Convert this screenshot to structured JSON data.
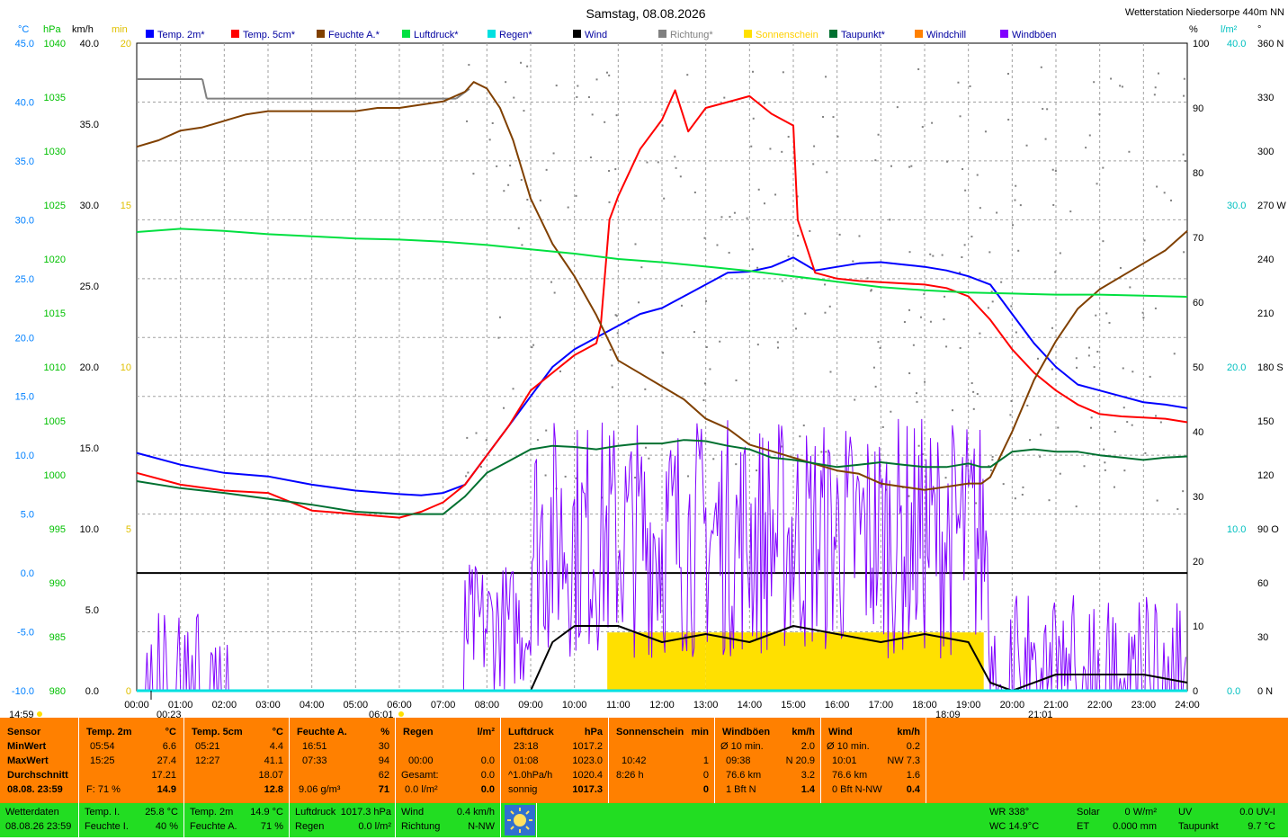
{
  "title": "Samstag, 08.08.2026",
  "station": "Wetterstation Niedersorpe 440m NN",
  "legend": [
    {
      "name": "Temp. 2m*",
      "color": "#0000ff"
    },
    {
      "name": "Temp. 5cm*",
      "color": "#ff0000"
    },
    {
      "name": "Feuchte A.*",
      "color": "#804000"
    },
    {
      "name": "Luftdruck*",
      "color": "#00e040"
    },
    {
      "name": "Regen*",
      "color": "#00e0e0"
    },
    {
      "name": "Wind",
      "color": "#000000"
    },
    {
      "name": "Richtung*",
      "color": "#808080"
    },
    {
      "name": "Sonnenschein",
      "color": "#ffe000"
    },
    {
      "name": "Taupunkt*",
      "color": "#007030"
    },
    {
      "name": "Windchill",
      "color": "#ff8000"
    },
    {
      "name": "Windböen",
      "color": "#8000ff"
    }
  ],
  "axis_units": {
    "temp": "°C",
    "hpa": "hPa",
    "kmh": "km/h",
    "min": "min",
    "pct": "%",
    "lm2": "l/m²",
    "deg": "°"
  },
  "axes": {
    "temp": {
      "color": "#0080ff",
      "ticks": [
        "45.0",
        "40.0",
        "35.0",
        "30.0",
        "25.0",
        "20.0",
        "15.0",
        "10.0",
        "5.0",
        "0.0",
        "-5.0",
        "-10.0"
      ]
    },
    "hpa": {
      "color": "#00c000",
      "ticks": [
        "1040",
        "1035",
        "1030",
        "1025",
        "1020",
        "1015",
        "1010",
        "1005",
        "1000",
        "995",
        "990",
        "985",
        "980"
      ]
    },
    "kmh": {
      "color": "#000000",
      "ticks": [
        "40.0",
        "35.0",
        "30.0",
        "25.0",
        "20.0",
        "15.0",
        "10.0",
        "5.0",
        "0.0"
      ]
    },
    "min": {
      "color": "#e0c000",
      "ticks": [
        "20",
        "15",
        "10",
        "5",
        "0"
      ]
    },
    "pct": {
      "color": "#000000",
      "ticks": [
        "100",
        "90",
        "80",
        "70",
        "60",
        "50",
        "40",
        "30",
        "20",
        "10",
        "0"
      ]
    },
    "lm2": {
      "color": "#00c0c0",
      "ticks": [
        "40.0",
        "30.0",
        "20.0",
        "10.0",
        "0.0"
      ]
    },
    "deg": {
      "color": "#000000",
      "ticks": [
        "360 N",
        "330",
        "300",
        "270 W",
        "240",
        "210",
        "180 S",
        "150",
        "120",
        "90 O",
        "60",
        "30",
        "0 N"
      ]
    }
  },
  "x_ticks": [
    "00:00",
    "01:00",
    "02:00",
    "03:00",
    "04:00",
    "05:00",
    "06:00",
    "07:00",
    "08:00",
    "09:00",
    "10:00",
    "11:00",
    "12:00",
    "13:00",
    "14:00",
    "15:00",
    "16:00",
    "17:00",
    "18:00",
    "19:00",
    "20:00",
    "21:00",
    "22:00",
    "23:00",
    "24:00"
  ],
  "markers": {
    "left": "14:59",
    "moonrise": "00:23",
    "sunrise": "06:01",
    "sunset": "18:09",
    "moonset": "21:01"
  },
  "chart_data": {
    "type": "line",
    "x_range": [
      0,
      24
    ],
    "series": [
      {
        "name": "Temp. 2m*",
        "axis": "temp",
        "color": "#0000ff",
        "x": [
          0,
          1,
          2,
          3,
          4,
          5,
          6,
          6.5,
          7,
          7.5,
          8,
          8.5,
          9,
          9.5,
          10,
          10.5,
          11,
          11.5,
          12,
          12.5,
          13,
          13.5,
          14,
          14.5,
          15,
          15.5,
          16,
          16.5,
          17,
          17.5,
          18,
          18.5,
          19,
          19.5,
          20,
          20.5,
          21,
          21.5,
          22,
          22.5,
          23,
          23.5,
          24
        ],
        "y": [
          10.2,
          9.2,
          8.5,
          8.2,
          7.5,
          7.0,
          6.7,
          6.6,
          6.8,
          7.5,
          10.0,
          12.5,
          15.0,
          17.5,
          19.0,
          20.0,
          21.0,
          22.0,
          22.5,
          23.5,
          24.5,
          25.5,
          25.6,
          26.0,
          26.8,
          25.7,
          26.0,
          26.3,
          26.4,
          26.2,
          26.0,
          25.7,
          25.2,
          24.5,
          22.0,
          19.5,
          17.5,
          16.0,
          15.5,
          15.0,
          14.5,
          14.3,
          14.0
        ]
      },
      {
        "name": "Temp. 5cm*",
        "axis": "temp",
        "color": "#ff0000",
        "x": [
          0,
          1,
          2,
          3,
          4,
          5,
          6,
          6.5,
          7,
          7.5,
          8,
          8.5,
          9,
          9.5,
          10,
          10.5,
          10.6,
          10.8,
          11,
          11.5,
          12,
          12.3,
          12.6,
          13,
          13.5,
          14,
          14.5,
          15,
          15.1,
          15.5,
          16,
          16.5,
          17,
          17.5,
          18,
          18.5,
          19,
          19.5,
          20,
          20.5,
          21,
          21.5,
          22,
          22.5,
          23,
          23.5,
          24
        ],
        "y": [
          8.5,
          7.5,
          7.0,
          6.8,
          5.3,
          5.0,
          4.7,
          5.2,
          6.0,
          7.5,
          10.0,
          12.5,
          15.5,
          17.0,
          18.5,
          19.5,
          21.0,
          30.0,
          32.0,
          36.0,
          38.5,
          41.0,
          37.5,
          39.5,
          40.0,
          40.5,
          39.0,
          38.0,
          30.0,
          25.5,
          25.0,
          24.8,
          24.7,
          24.6,
          24.5,
          24.2,
          23.5,
          21.5,
          19.0,
          17.0,
          15.5,
          14.3,
          13.5,
          13.3,
          13.2,
          13.1,
          12.8
        ]
      },
      {
        "name": "Feuchte A.*",
        "axis": "pct",
        "color": "#804000",
        "x": [
          0,
          0.5,
          1,
          1.5,
          2,
          2.5,
          3,
          3.5,
          4,
          5,
          5.5,
          6,
          6.5,
          7,
          7.5,
          7.7,
          8,
          8.3,
          8.6,
          9,
          9.5,
          10,
          10.5,
          11,
          11.5,
          12,
          12.5,
          13,
          13.5,
          14,
          14.5,
          15,
          15.5,
          16,
          16.5,
          17,
          17.5,
          18,
          18.5,
          19,
          19.3,
          19.5,
          20,
          20.5,
          21,
          21.5,
          22,
          22.5,
          23,
          23.5,
          24
        ],
        "y": [
          84,
          85,
          86.5,
          87,
          88,
          89,
          89.5,
          89.5,
          89.5,
          89.5,
          90,
          90,
          90.5,
          91,
          92.5,
          94,
          93,
          90,
          85,
          76,
          69,
          64,
          58,
          51,
          49,
          47,
          45,
          42,
          40.5,
          38,
          37,
          36,
          35,
          34,
          33.5,
          32,
          31.5,
          31,
          31.5,
          32,
          32,
          33,
          40,
          48,
          54,
          59,
          62,
          64,
          66,
          68,
          71
        ]
      },
      {
        "name": "Luftdruck*",
        "axis": "hpa",
        "color": "#00e040",
        "x": [
          0,
          1,
          2,
          3,
          4,
          5,
          6,
          7,
          8,
          9,
          10,
          11,
          12,
          13,
          14,
          15,
          16,
          17,
          18,
          19,
          20,
          21,
          22,
          23,
          24
        ],
        "y": [
          1022.5,
          1022.8,
          1022.6,
          1022.3,
          1022.1,
          1021.9,
          1021.8,
          1021.6,
          1021.3,
          1020.9,
          1020.5,
          1020.0,
          1019.7,
          1019.3,
          1018.9,
          1018.4,
          1017.9,
          1017.4,
          1017.1,
          1016.9,
          1016.8,
          1016.7,
          1016.7,
          1016.6,
          1016.5
        ]
      },
      {
        "name": "Taupunkt*",
        "axis": "temp",
        "color": "#007030",
        "x": [
          0,
          1,
          2,
          3,
          4,
          5,
          6,
          7,
          7.5,
          8,
          8.5,
          9,
          9.5,
          10,
          10.5,
          11,
          11.5,
          12,
          12.5,
          13,
          13.5,
          14,
          14.5,
          15,
          15.5,
          16,
          16.5,
          17,
          17.5,
          18,
          18.5,
          19,
          19.3,
          19.5,
          20,
          20.5,
          21,
          21.5,
          22,
          22.5,
          23,
          23.5,
          24
        ],
        "y": [
          7.8,
          7.2,
          6.8,
          6.3,
          5.8,
          5.2,
          5.0,
          5.0,
          6.5,
          8.5,
          9.5,
          10.5,
          10.8,
          10.7,
          10.5,
          10.8,
          11.0,
          11.0,
          11.3,
          11.2,
          10.8,
          10.5,
          9.8,
          9.6,
          9.3,
          9.0,
          9.2,
          9.4,
          9.2,
          9.0,
          9.0,
          9.3,
          9.0,
          9.0,
          10.3,
          10.5,
          10.3,
          10.3,
          10.0,
          9.8,
          9.6,
          9.8,
          9.9
        ]
      },
      {
        "name": "Wind",
        "axis": "kmh",
        "color": "#000000",
        "x": [
          0,
          9,
          9.5,
          10,
          11,
          12,
          13,
          14,
          15,
          16,
          17,
          18,
          19,
          19.5,
          20,
          21,
          22,
          23,
          24
        ],
        "y": [
          0,
          0,
          3,
          4,
          4,
          3,
          3.5,
          3,
          4,
          3.5,
          3,
          3.5,
          3,
          0.5,
          0,
          1,
          1,
          1,
          0.5
        ]
      },
      {
        "name": "Regen*",
        "axis": "lm2",
        "color": "#00e0e0",
        "x": [
          0,
          24
        ],
        "y": [
          0,
          0
        ]
      }
    ],
    "sunshine_blocks": [
      [
        10.75,
        13.0
      ],
      [
        13.0,
        19.35
      ]
    ],
    "zero_reference": {
      "axis": "temp",
      "y": 0.0
    }
  },
  "panel": {
    "sensor": {
      "h": "Sensor",
      "min": "MinWert",
      "max": "MaxWert",
      "avg": "Durchschnitt",
      "date": "08.08. 23:59"
    },
    "t2m": {
      "h": "Temp. 2m",
      "u": "°C",
      "min_t": "05:54",
      "min_v": "6.6",
      "max_t": "15:25",
      "max_v": "27.4",
      "avg": "17.21",
      "f": "F: 71 %",
      "cur": "14.9"
    },
    "t5cm": {
      "h": "Temp. 5cm",
      "u": "°C",
      "min_t": "05:21",
      "min_v": "4.4",
      "max_t": "12:27",
      "max_v": "41.1",
      "avg": "18.07",
      "cur": "12.8"
    },
    "hum": {
      "h": "Feuchte A.",
      "u": "%",
      "min_t": "16:51",
      "min_v": "30",
      "max_t": "07:33",
      "max_v": "94",
      "avg": "62",
      "abs": "9.06 g/m³",
      "cur": "71"
    },
    "rain": {
      "h": "Regen",
      "u": "l/m²",
      "r1_t": "00:00",
      "r1_v": "0.0",
      "ges_l": "Gesamt:",
      "ges_v": "0.0",
      "r4_l": "0.0 l/m²",
      "cur": "0.0"
    },
    "press": {
      "h": "Luftdruck",
      "u": "hPa",
      "min_t": "23:18",
      "min_v": "1017.2",
      "max_t": "01:08",
      "max_v": "1023.0",
      "trend_l": "^1.0hPa/h",
      "trend_v": "1020.4",
      "state": "sonnig",
      "cur": "1017.3"
    },
    "sun": {
      "h": "Sonnenschein",
      "u": "min",
      "r1_t": "10:42",
      "r1_v": "1",
      "r2_t": "8:26 h",
      "r2_v": "0",
      "cur": "0"
    },
    "gust": {
      "h": "Windböen",
      "u": "km/h",
      "avg_l": "Ø 10 min.",
      "avg_v": "2.0",
      "max_t": "09:38",
      "max_v": "N 20.9",
      "km": "76.6 km",
      "km_v": "3.2",
      "bft": "1 Bft N",
      "cur": "1.4"
    },
    "wind": {
      "h": "Wind",
      "u": "km/h",
      "avg_l": "Ø 10 min.",
      "avg_v": "0.2",
      "max_t": "10:01",
      "max_v": "NW 7.3",
      "km": "76.6 km",
      "km_v": "1.6",
      "bft": "0 Bft N-NW",
      "cur": "0.4"
    }
  },
  "bottom": {
    "wd": "Wetterdaten",
    "wd_date": "08.08.26 23:59",
    "ti_l": "Temp. I.",
    "ti_v": "25.8 °C",
    "fi_l": "Feuchte I.",
    "fi_v": "40 %",
    "t2_l": "Temp. 2m",
    "t2_v": "14.9 °C",
    "fa_l": "Feuchte A.",
    "fa_v": "71 %",
    "lp_l": "Luftdruck",
    "lp_v": "1017.3 hPa",
    "rg_l": "Regen",
    "rg_v": "0.0 l/m²",
    "wi_l": "Wind",
    "wi_v": "0.4 km/h",
    "ri_l": "Richtung",
    "ri_v": "N-NW",
    "wr": "WR 338°",
    "wc": "WC 14.9°C",
    "so_l": "Solar",
    "so_v": "0 W/m²",
    "et_l": "ET",
    "et_v": "0.000 mm",
    "uv_l": "UV",
    "uv_v": "0.0 UV-I",
    "tp_l": "Taupunkt",
    "tp_v": "9.7 °C"
  }
}
